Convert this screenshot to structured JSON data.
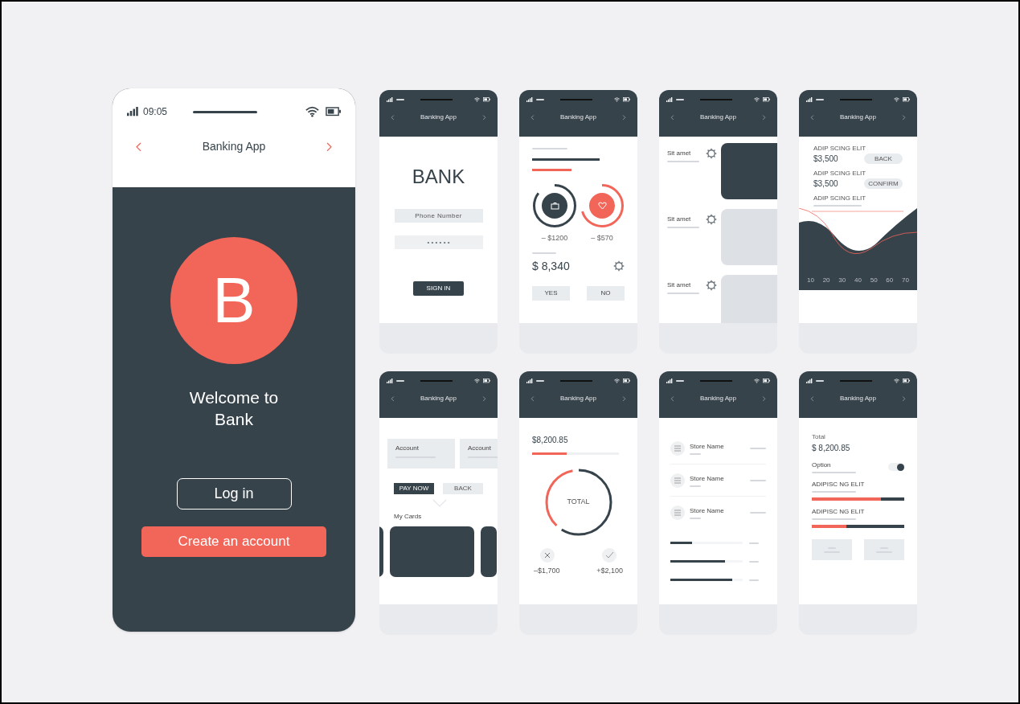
{
  "main_phone": {
    "time": "09:05",
    "title": "Banking App",
    "logo": "B",
    "welcome": "Welcome to Bank",
    "login_button": "Log in",
    "create_button": "Create an account"
  },
  "screens": [
    {
      "kind": "login",
      "title": "Banking App",
      "heading": "BANK",
      "phone_placeholder": "Phone Number",
      "password_placeholder": "• • • • • •",
      "button": "SIGN IN"
    },
    {
      "kind": "rings",
      "title": "Banking App",
      "rings": [
        {
          "color": "#37434b",
          "amount": "– $1200"
        },
        {
          "color": "#f26559",
          "amount": "– $570"
        }
      ],
      "balance": "$ 8,340",
      "buttons": [
        "YES",
        "NO"
      ]
    },
    {
      "kind": "cards",
      "title": "Banking App",
      "rows": [
        {
          "label": "Sit amet",
          "selected": true
        },
        {
          "label": "Sit amet",
          "selected": false
        },
        {
          "label": "Sit amet",
          "selected": false
        }
      ]
    },
    {
      "kind": "chart",
      "title": "Banking App",
      "entries": [
        {
          "label": "ADIP SCING ELIT",
          "amount": "$3,500",
          "button": "BACK"
        },
        {
          "label": "ADIP SCING ELIT",
          "amount": "$3,500",
          "button": "CONFIRM"
        }
      ],
      "chart_label": "ADIP SCING ELIT",
      "axis_labels": [
        "10",
        "20",
        "30",
        "40",
        "50",
        "60",
        "70"
      ]
    },
    {
      "kind": "accounts",
      "title": "Banking App",
      "accounts": [
        "Account",
        "Account"
      ],
      "buttons": [
        {
          "label": "PAY NOW",
          "selected": true
        },
        {
          "label": "BACK",
          "selected": false
        }
      ],
      "cards_heading": "My Cards"
    },
    {
      "kind": "total",
      "title": "Banking App",
      "balance": "$8,200.85",
      "progress": {
        "level": 0.4
      },
      "donut": {
        "label": "TOTAL"
      },
      "amounts": [
        "–$1,700",
        "+$2,100"
      ]
    },
    {
      "kind": "stores",
      "title": "Banking App",
      "stores": [
        "Store Name",
        "Store Name",
        "Store Name"
      ],
      "bars": [
        {
          "level": 0.3
        },
        {
          "level": 0.75
        },
        {
          "level": 0.85
        }
      ]
    },
    {
      "kind": "settings",
      "title": "Banking App",
      "total_label": "Total",
      "total": "$ 8,200.85",
      "option": {
        "label": "Option",
        "on": true
      },
      "meters": [
        {
          "label": "ADIPISC NG ELIT",
          "level": 0.75
        },
        {
          "label": "ADIPISC NG ELIT",
          "level": 0.37
        }
      ]
    }
  ]
}
